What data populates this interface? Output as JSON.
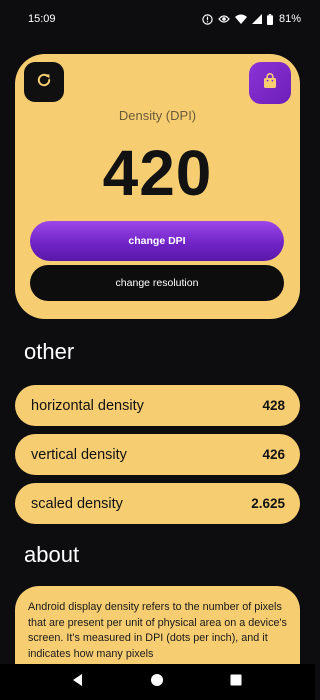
{
  "status_bar": {
    "time": "15:09",
    "battery": "81%",
    "icons": [
      "alert-circle-icon",
      "eye-icon",
      "wifi-icon",
      "signal-icon",
      "battery-icon"
    ]
  },
  "main_card": {
    "refresh_icon": "refresh-icon",
    "shop_icon": "shopping-bag-icon",
    "label": "Density (DPI)",
    "value": "420",
    "change_dpi_label": "change DPI",
    "change_resolution_label": "change resolution"
  },
  "other": {
    "heading": "other",
    "rows": [
      {
        "label": "horizontal density",
        "value": "428"
      },
      {
        "label": "vertical density",
        "value": "426"
      },
      {
        "label": "scaled density",
        "value": "2.625"
      }
    ]
  },
  "about": {
    "heading": "about",
    "text": "Android display density refers to the number of pixels that are present per unit of physical area on a device's screen. It's measured in DPI (dots per inch), and it indicates how many pixels"
  },
  "nav_bar": {
    "icons": [
      "back-icon",
      "home-icon",
      "recents-icon"
    ]
  },
  "colors": {
    "background": "#0d0d0f",
    "card": "#f7cd72",
    "accent_purple": "#7a2ad0",
    "button_dark": "#0d0d0d"
  }
}
